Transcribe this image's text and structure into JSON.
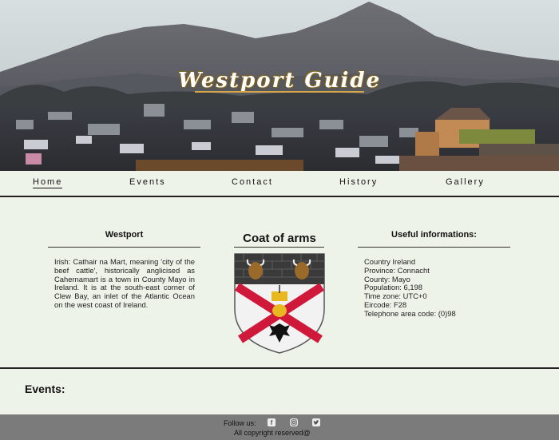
{
  "hero": {
    "title": "Westport Guide"
  },
  "nav": {
    "items": [
      {
        "label": "Home"
      },
      {
        "label": "Events"
      },
      {
        "label": "Contact"
      },
      {
        "label": "History"
      },
      {
        "label": "Gallery"
      }
    ]
  },
  "westport": {
    "heading": "Westport",
    "text": "Irish: Cathair na Mart, meaning 'city of the beef cattle', historically anglicised as Cahernamart is a town in County Mayo in Ireland. It is at the south-east corner of Clew Bay, an inlet of the Atlantic Ocean on the west coast of Ireland."
  },
  "coat": {
    "heading": "Coat of arms"
  },
  "info": {
    "heading": "Useful informations:",
    "lines": [
      "Country Ireland",
      "Province: Connacht",
      "County: Mayo",
      "Population: 6,198",
      "Time zone: UTC+0",
      "Eircode: F28",
      "Telephone area code: (0)98"
    ]
  },
  "events": {
    "heading": "Events:"
  },
  "footer": {
    "follow_label": "Follow us:",
    "copyright": "All copyright reserved@"
  },
  "icons": [
    "facebook-icon",
    "instagram-icon",
    "twitter-icon"
  ]
}
